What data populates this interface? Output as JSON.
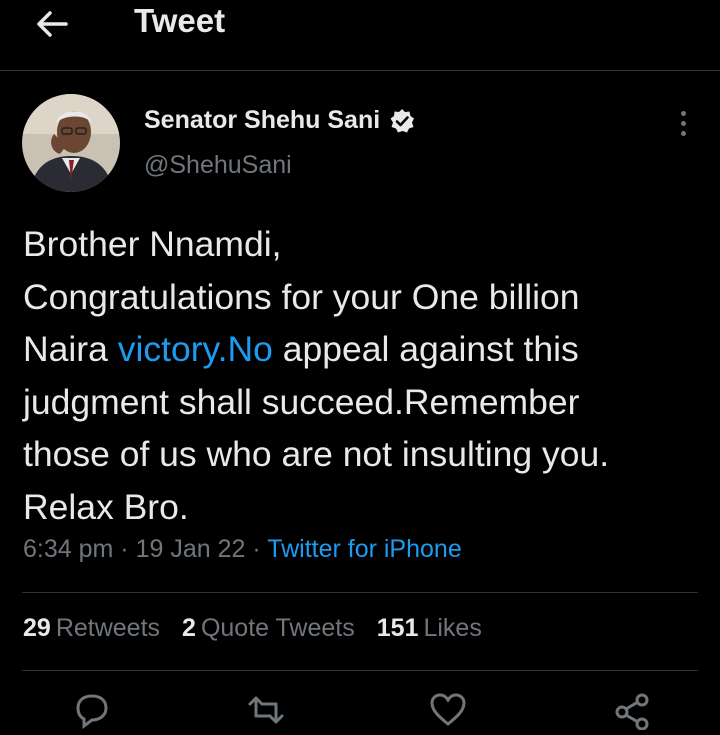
{
  "header": {
    "title": "Tweet"
  },
  "author": {
    "name": "Senator Shehu Sani",
    "handle": "@ShehuSani",
    "verified": true
  },
  "tweet": {
    "lines": [
      [
        {
          "t": "Brother Nnamdi,"
        }
      ],
      [
        {
          "t": "Congratulations for your One billion"
        }
      ],
      [
        {
          "t": "Naira "
        },
        {
          "t": "victory.No",
          "link": true
        },
        {
          "t": " appeal against this"
        }
      ],
      [
        {
          "t": "judgment shall succeed.Remember"
        }
      ],
      [
        {
          "t": "those of us who are not insulting you."
        }
      ],
      [
        {
          "t": "Relax Bro."
        }
      ]
    ]
  },
  "meta": {
    "time": "6:34 pm",
    "date": "19 Jan 22",
    "source": "Twitter for iPhone",
    "separator": "·"
  },
  "stats": {
    "retweets_count": "29",
    "retweets_label": "Retweets",
    "quotes_count": "2",
    "quotes_label": "Quote Tweets",
    "likes_count": "151",
    "likes_label": "Likes"
  },
  "colors": {
    "background": "#000000",
    "text": "#e7e9ea",
    "secondary": "#71767b",
    "link": "#1d9bf0",
    "divider": "#2f3336"
  },
  "icons": [
    "back-arrow-icon",
    "verified-badge-icon",
    "more-options-icon",
    "reply-icon",
    "retweet-icon",
    "like-icon",
    "share-icon"
  ]
}
